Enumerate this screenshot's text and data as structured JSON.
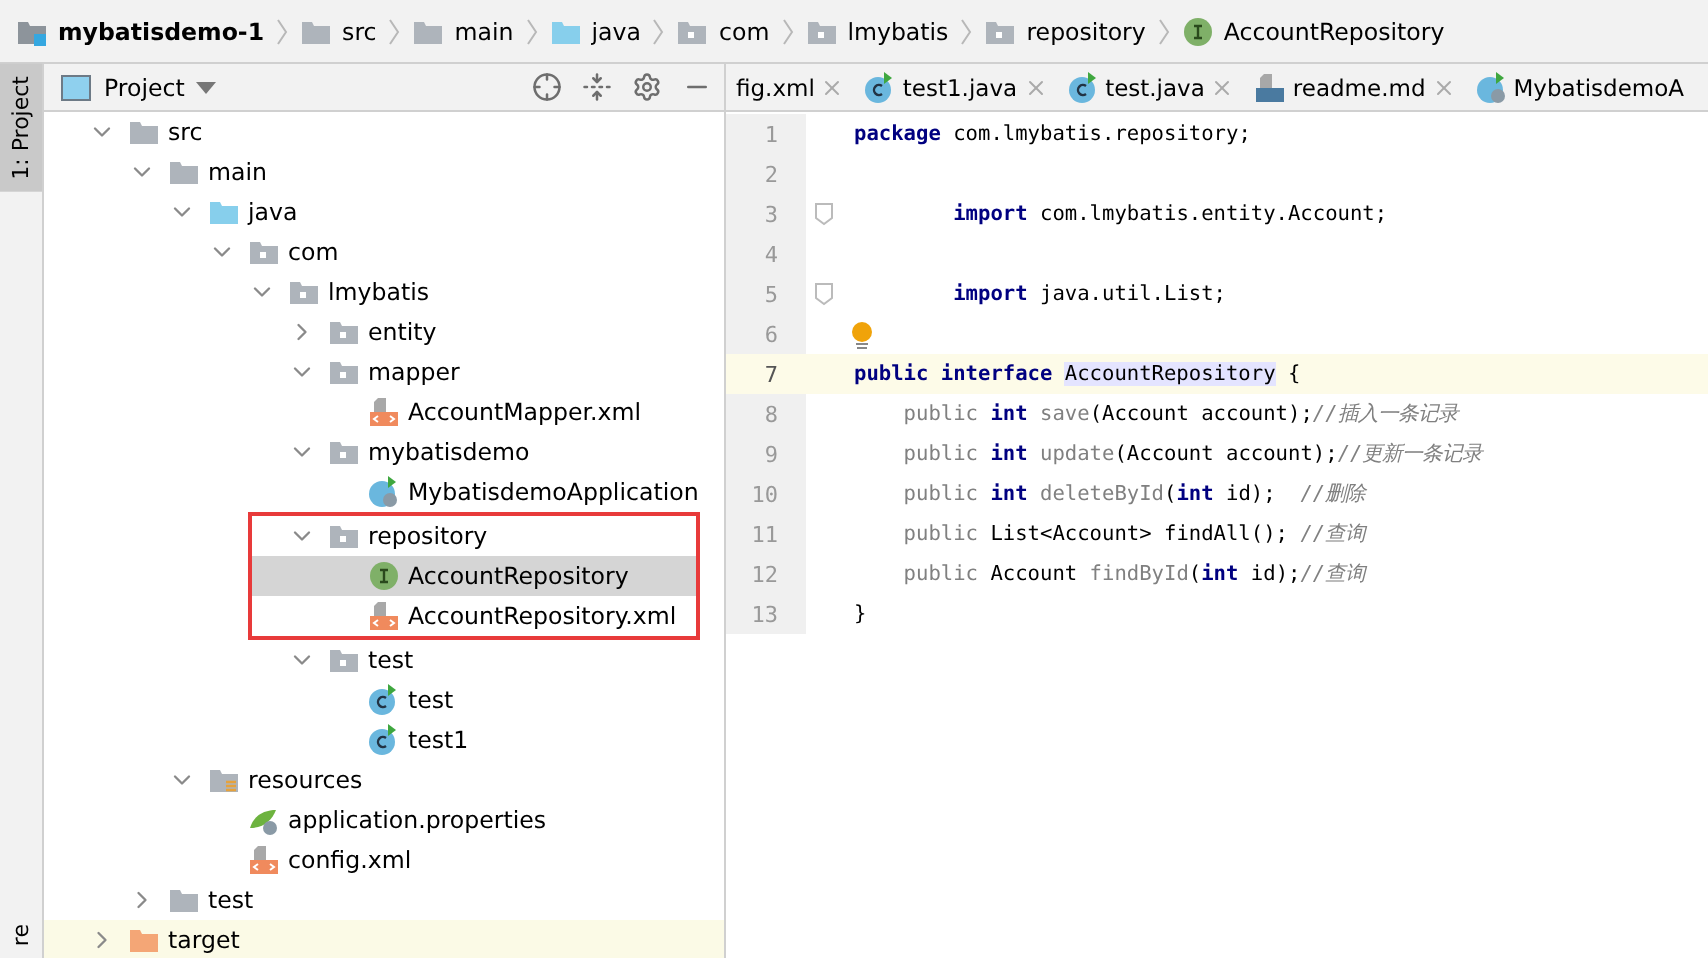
{
  "breadcrumbs": [
    {
      "label": "mybatisdemo-1",
      "kind": "module"
    },
    {
      "label": "src",
      "kind": "folder"
    },
    {
      "label": "main",
      "kind": "folder"
    },
    {
      "label": "java",
      "kind": "source-folder"
    },
    {
      "label": "com",
      "kind": "package"
    },
    {
      "label": "lmybatis",
      "kind": "package"
    },
    {
      "label": "repository",
      "kind": "package"
    },
    {
      "label": "AccountRepository",
      "kind": "interface"
    }
  ],
  "side_tabs_top": [
    {
      "label": "1: Project",
      "selected": true
    }
  ],
  "side_tabs_bottom": [
    {
      "label": "re",
      "selected": false
    }
  ],
  "project_panel": {
    "title": "Project",
    "tree": [
      {
        "label": "src",
        "kind": "folder",
        "expanded": true,
        "selected": false,
        "children": [
          {
            "label": "main",
            "kind": "folder",
            "expanded": true,
            "selected": false,
            "children": [
              {
                "label": "java",
                "kind": "source-folder",
                "expanded": true,
                "selected": false,
                "children": [
                  {
                    "label": "com",
                    "kind": "package",
                    "expanded": true,
                    "selected": false,
                    "children": [
                      {
                        "label": "lmybatis",
                        "kind": "package",
                        "expanded": true,
                        "selected": false,
                        "children": [
                          {
                            "label": "entity",
                            "kind": "package",
                            "expanded": false,
                            "selected": false
                          },
                          {
                            "label": "mapper",
                            "kind": "package",
                            "expanded": true,
                            "selected": false,
                            "children": [
                              {
                                "label": "AccountMapper.xml",
                                "kind": "xml",
                                "selected": false
                              }
                            ]
                          },
                          {
                            "label": "mybatisdemo",
                            "kind": "package",
                            "expanded": true,
                            "selected": false,
                            "children": [
                              {
                                "label": "MybatisdemoApplication",
                                "kind": "spring-class",
                                "selected": false
                              }
                            ]
                          },
                          {
                            "label": "repository",
                            "kind": "package",
                            "expanded": true,
                            "selected": false,
                            "framed": true,
                            "children": [
                              {
                                "label": "AccountRepository",
                                "kind": "interface",
                                "selected": true
                              },
                              {
                                "label": "AccountRepository.xml",
                                "kind": "xml",
                                "selected": false
                              }
                            ]
                          },
                          {
                            "label": "test",
                            "kind": "package",
                            "expanded": true,
                            "selected": false,
                            "children": [
                              {
                                "label": "test",
                                "kind": "class",
                                "selected": false
                              },
                              {
                                "label": "test1",
                                "kind": "class",
                                "selected": false
                              }
                            ]
                          }
                        ]
                      }
                    ]
                  }
                ]
              },
              {
                "label": "resources",
                "kind": "resources-folder",
                "expanded": true,
                "selected": false,
                "children": [
                  {
                    "label": "application.properties",
                    "kind": "properties",
                    "selected": false
                  },
                  {
                    "label": "config.xml",
                    "kind": "xml",
                    "selected": false
                  }
                ]
              }
            ]
          },
          {
            "label": "test",
            "kind": "folder",
            "expanded": false,
            "selected": false
          }
        ]
      },
      {
        "label": "target",
        "kind": "excluded-folder",
        "expanded": false,
        "selected": false
      }
    ]
  },
  "editor_tabs": [
    {
      "label": "fig.xml",
      "closable": true,
      "selected": false
    },
    {
      "label": "test1.java",
      "kind": "class",
      "closable": true,
      "selected": false
    },
    {
      "label": "test.java",
      "kind": "class",
      "closable": true,
      "selected": false
    },
    {
      "label": "readme.md",
      "kind": "markdown",
      "closable": true,
      "selected": false
    },
    {
      "label": "MybatisdemoA",
      "kind": "spring-class",
      "closable": false,
      "selected": false
    }
  ],
  "editor": {
    "lines": [
      {
        "number": "1",
        "segments": [
          {
            "kind": "keyword",
            "text": "package"
          },
          {
            "kind": "plain",
            "text": " com.lmybatis.repository;"
          }
        ]
      },
      {
        "number": "2"
      },
      {
        "number": "3",
        "fold": true,
        "segments": [
          {
            "kind": "keyword",
            "text": "        import"
          },
          {
            "kind": "plain",
            "text": " com.lmybatis.entity.Account;"
          }
        ]
      },
      {
        "number": "4"
      },
      {
        "number": "5",
        "fold": true,
        "segments": [
          {
            "kind": "keyword",
            "text": "        import"
          },
          {
            "kind": "plain",
            "text": " java.util.List;"
          }
        ]
      },
      {
        "number": "6",
        "bulb": true
      },
      {
        "number": "7",
        "current": true,
        "segments": [
          {
            "kind": "keyword",
            "text": "public interface "
          },
          {
            "kind": "highlight",
            "text": "AccountRepository"
          },
          {
            "kind": "plain",
            "text": " {"
          }
        ]
      },
      {
        "number": "8",
        "segments": [
          {
            "kind": "dim",
            "text": "    public"
          },
          {
            "kind": "keyword",
            "text": " int"
          },
          {
            "kind": "dim",
            "text": " save"
          },
          {
            "kind": "plain",
            "text": "(Account account);"
          },
          {
            "kind": "comment",
            "text": "//插入一条记录"
          }
        ]
      },
      {
        "number": "9",
        "segments": [
          {
            "kind": "dim",
            "text": "    public"
          },
          {
            "kind": "keyword",
            "text": " int"
          },
          {
            "kind": "dim",
            "text": " update"
          },
          {
            "kind": "plain",
            "text": "(Account account);"
          },
          {
            "kind": "comment",
            "text": "//更新一条记录"
          }
        ]
      },
      {
        "number": "10",
        "segments": [
          {
            "kind": "dim",
            "text": "    public"
          },
          {
            "kind": "keyword",
            "text": " int"
          },
          {
            "kind": "dim",
            "text": " deleteById"
          },
          {
            "kind": "plain",
            "text": "("
          },
          {
            "kind": "keyword",
            "text": "int"
          },
          {
            "kind": "plain",
            "text": " id);  "
          },
          {
            "kind": "comment",
            "text": "//删除"
          }
        ]
      },
      {
        "number": "11",
        "segments": [
          {
            "kind": "dim",
            "text": "    public"
          },
          {
            "kind": "plain",
            "text": " List<Account> findAll(); "
          },
          {
            "kind": "comment",
            "text": "//查询"
          }
        ]
      },
      {
        "number": "12",
        "segments": [
          {
            "kind": "dim",
            "text": "    public"
          },
          {
            "kind": "plain",
            "text": " Account "
          },
          {
            "kind": "dim",
            "text": "findById"
          },
          {
            "kind": "plain",
            "text": "("
          },
          {
            "kind": "keyword",
            "text": "int"
          },
          {
            "kind": "plain",
            "text": " id);"
          },
          {
            "kind": "comment",
            "text": "//查询"
          }
        ]
      },
      {
        "number": "13",
        "segments": [
          {
            "kind": "plain",
            "text": "}"
          }
        ]
      }
    ]
  }
}
